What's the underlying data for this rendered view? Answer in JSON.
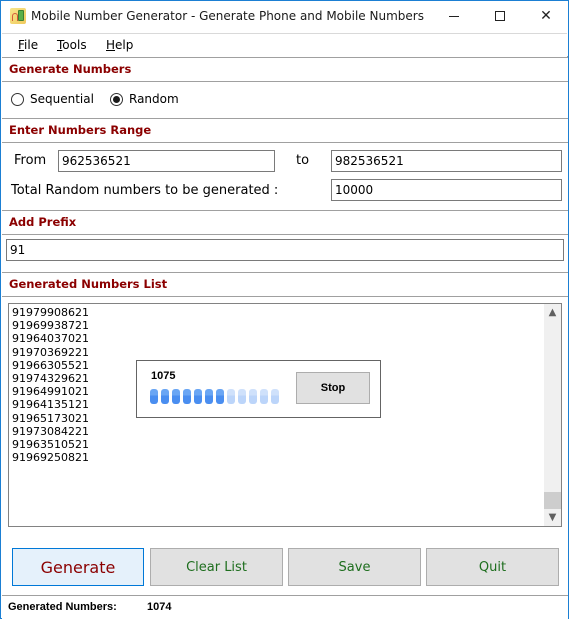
{
  "window": {
    "title": "Mobile Number Generator - Generate Phone and Mobile Numbers",
    "controls": {
      "minimize": "minimize",
      "maximize": "maximize",
      "close": "✕"
    }
  },
  "menu": {
    "items": [
      {
        "accel": "F",
        "rest": "ile"
      },
      {
        "accel": "T",
        "rest": "ools"
      },
      {
        "accel": "H",
        "rest": "elp"
      }
    ]
  },
  "generate_section": {
    "header": "Generate Numbers",
    "options": [
      {
        "label": "Sequential",
        "checked": false
      },
      {
        "label": "Random",
        "checked": true
      }
    ]
  },
  "range_section": {
    "header": "Enter Numbers Range",
    "from_label": "From",
    "from_value": "962536521",
    "to_label": "to",
    "to_value": "982536521",
    "total_label": "Total Random numbers to be generated :",
    "total_value": "10000"
  },
  "prefix_section": {
    "header": "Add Prefix",
    "value": "91"
  },
  "list_section": {
    "header": "Generated Numbers List",
    "items": [
      "91979908621",
      "91969938721",
      "91964037021",
      "91970369221",
      "91966305521",
      "91974329621",
      "91964991021",
      "91964135121",
      "91965173021",
      "91973084221",
      "91963510521",
      "91969250821"
    ]
  },
  "progress": {
    "count": "1075",
    "segments_total": 12,
    "segments_filled": 7,
    "stop_label": "Stop",
    "colors": {
      "filled": "#4a8ef0",
      "empty": "#bcd5fa"
    }
  },
  "buttons": {
    "generate": "Generate",
    "clear": "Clear List",
    "save": "Save",
    "quit": "Quit"
  },
  "status": {
    "label": "Generated Numbers:",
    "value": "1074"
  },
  "colors": {
    "section_header": "#8b0000",
    "button_text": "#1e6e1e",
    "window_border": "#1b7fd3"
  }
}
